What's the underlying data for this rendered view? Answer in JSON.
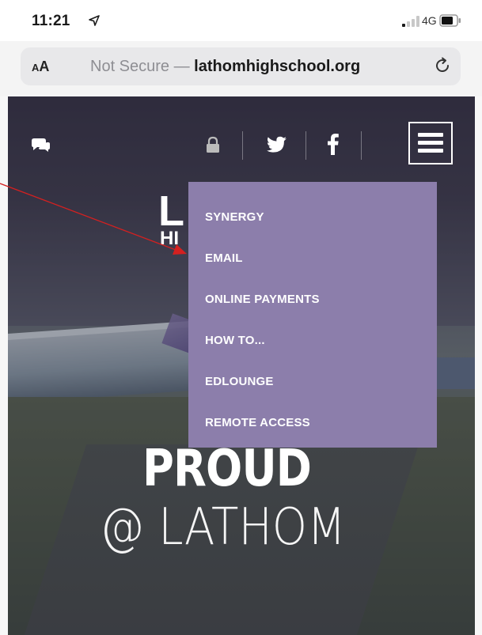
{
  "status_bar": {
    "time": "11:21",
    "network": "4G"
  },
  "browser": {
    "aa_label_small": "A",
    "aa_label_large": "A",
    "insecure_label": "Not Secure — ",
    "domain": "lathomhighschool.org"
  },
  "header": {
    "icons": [
      "chat-icon",
      "lock-icon",
      "twitter-icon",
      "facebook-icon",
      "menu-icon"
    ]
  },
  "logo": {
    "letter_top": "L",
    "letter_bottom": "HI"
  },
  "hero": {
    "headline_line1": "PROUD",
    "headline_line2": "@ LATHOM"
  },
  "dropdown": {
    "items": [
      {
        "label": "SYNERGY"
      },
      {
        "label": "EMAIL"
      },
      {
        "label": "ONLINE PAYMENTS"
      },
      {
        "label": "HOW TO..."
      },
      {
        "label": "EDLOUNGE"
      },
      {
        "label": "REMOTE ACCESS"
      }
    ]
  },
  "colors": {
    "menu_bg": "#8c7eab",
    "annotation_arrow": "#d42020",
    "hero_overlay": "#282438"
  }
}
